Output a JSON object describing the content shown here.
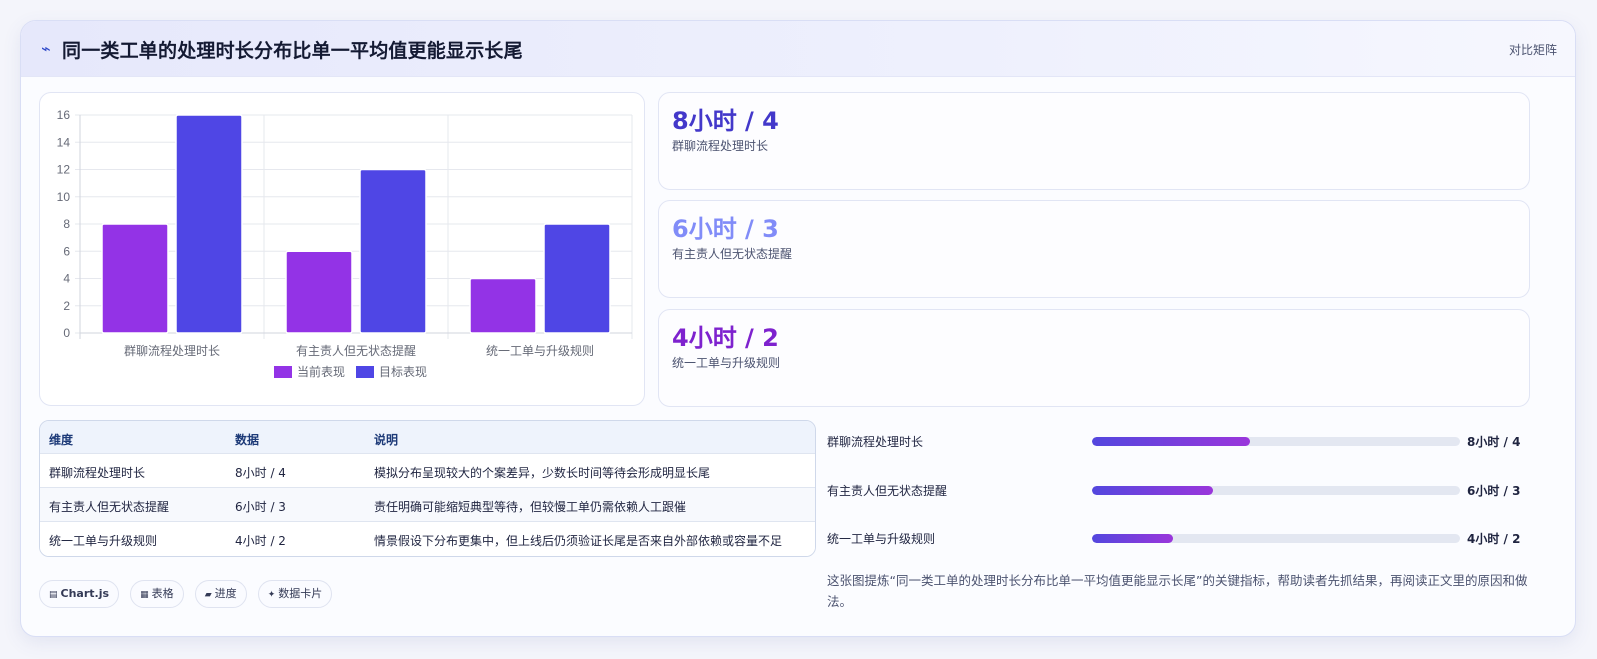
{
  "header": {
    "icon": "trend-icon",
    "title": "同一类工单的处理时长分布比单一平均值更能显示长尾",
    "tag": "对比矩阵"
  },
  "colors": {
    "current": "#9333e6",
    "target": "#4f46e5",
    "stat_values": [
      "#4338ca",
      "#818cf8",
      "#7e22ce"
    ]
  },
  "chart_data": {
    "type": "bar",
    "categories": [
      "群聊流程处理时长",
      "有主责人但无状态提醒",
      "统一工单与升级规则"
    ],
    "series": [
      {
        "name": "当前表现",
        "values": [
          8,
          6,
          4
        ],
        "color": "#9333e6"
      },
      {
        "name": "目标表现",
        "values": [
          16,
          12,
          8
        ],
        "color": "#4f46e5"
      }
    ],
    "yticks": [
      0,
      2,
      4,
      6,
      8,
      10,
      12,
      14,
      16
    ],
    "ylim": [
      0,
      16
    ],
    "grid": true,
    "legend": "bottom",
    "xlabel": "",
    "ylabel": "",
    "title": ""
  },
  "stats": [
    {
      "value": "8小时 / 4",
      "label": "群聊流程处理时长"
    },
    {
      "value": "6小时 / 3",
      "label": "有主责人但无状态提醒"
    },
    {
      "value": "4小时 / 2",
      "label": "统一工单与升级规则"
    }
  ],
  "table": {
    "headers": [
      "维度",
      "数据",
      "说明"
    ],
    "rows": [
      [
        "群聊流程处理时长",
        "8小时 / 4",
        "模拟分布呈现较大的个案差异，少数长时间等待会形成明显长尾"
      ],
      [
        "有主责人但无状态提醒",
        "6小时 / 3",
        "责任明确可能缩短典型等待，但较慢工单仍需依赖人工跟催"
      ],
      [
        "统一工单与升级规则",
        "4小时 / 2",
        "情景假设下分布更集中，但上线后仍须验证长尾是否来自外部依赖或容量不足"
      ]
    ]
  },
  "progress": [
    {
      "label": "群聊流程处理时长",
      "value": "8小时 / 4",
      "fraction": 0.43
    },
    {
      "label": "有主责人但无状态提醒",
      "value": "6小时 / 3",
      "fraction": 0.33
    },
    {
      "label": "统一工单与升级规则",
      "value": "4小时 / 2",
      "fraction": 0.22
    }
  ],
  "chips": [
    {
      "icon": "chart-icon",
      "glyph": "▤",
      "label": "Chart.js"
    },
    {
      "icon": "table-icon",
      "glyph": "▦",
      "label": "表格"
    },
    {
      "icon": "progress-icon",
      "glyph": "▰",
      "label": "进度"
    },
    {
      "icon": "sparkle-icon",
      "glyph": "✦",
      "label": "数据卡片"
    }
  ],
  "summary": "这张图提炼“同一类工单的处理时长分布比单一平均值更能显示长尾”的关键指标，帮助读者先抓结果，再阅读正文里的原因和做法。"
}
